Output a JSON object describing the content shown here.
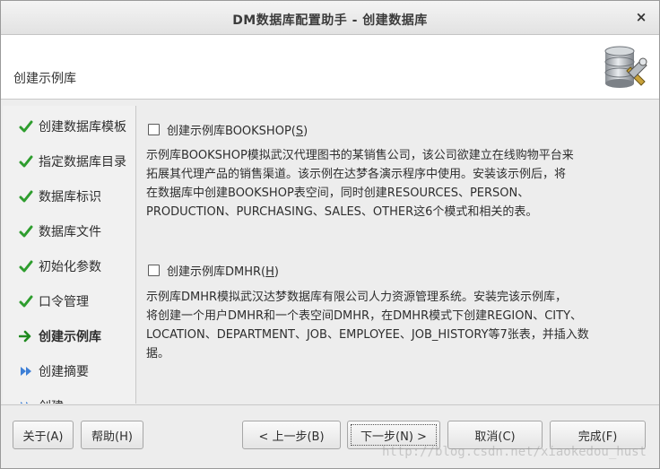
{
  "window": {
    "title": "DM数据库配置助手 - 创建数据库",
    "close_glyph": "×"
  },
  "header": {
    "title": "创建示例库",
    "logo_icon": "database-wrench-icon"
  },
  "sidebar": {
    "items": [
      {
        "label": "创建数据库模板",
        "state": "done"
      },
      {
        "label": "指定数据库目录",
        "state": "done"
      },
      {
        "label": "数据库标识",
        "state": "done"
      },
      {
        "label": "数据库文件",
        "state": "done"
      },
      {
        "label": "初始化参数",
        "state": "done"
      },
      {
        "label": "口令管理",
        "state": "done"
      },
      {
        "label": "创建示例库",
        "state": "current"
      },
      {
        "label": "创建摘要",
        "state": "pending"
      },
      {
        "label": "创建",
        "state": "pending"
      }
    ]
  },
  "options": {
    "bookshop": {
      "label_prefix": "创建示例库BOOKSHOP(",
      "mnemonic": "S",
      "label_suffix": ")",
      "checked": false,
      "desc": [
        "示例库BOOKSHOP模拟武汉代理图书的某销售公司，该公司欲建立在线购物平台来",
        "拓展其代理产品的销售渠道。该示例在达梦各演示程序中使用。安装该示例后，将",
        "在数据库中创建BOOKSHOP表空间，同时创建RESOURCES、PERSON、",
        "PRODUCTION、PURCHASING、SALES、OTHER这6个模式和相关的表。"
      ]
    },
    "dmhr": {
      "label_prefix": "创建示例库DMHR(",
      "mnemonic": "H",
      "label_suffix": ")",
      "checked": false,
      "desc": [
        "示例库DMHR模拟武汉达梦数据库有限公司人力资源管理系统。安装完该示例库，",
        "将创建一个用户DMHR和一个表空间DMHR，在DMHR模式下创建REGION、CITY、",
        "LOCATION、DEPARTMENT、JOB、EMPLOYEE、JOB_HISTORY等7张表，并插入数",
        "据。"
      ]
    }
  },
  "buttons": {
    "about": "关于(A)",
    "help": "帮助(H)",
    "prev": "< 上一步(B)",
    "next": "下一步(N) >",
    "cancel": "取消(C)",
    "finish": "完成(F)"
  },
  "watermark": "http://blog.csdn.net/xiaokedou_hust",
  "colors": {
    "check_green": "#2e9d2e",
    "arrow_green": "#1f8a1f",
    "pending_blue": "#3d7fd6"
  }
}
